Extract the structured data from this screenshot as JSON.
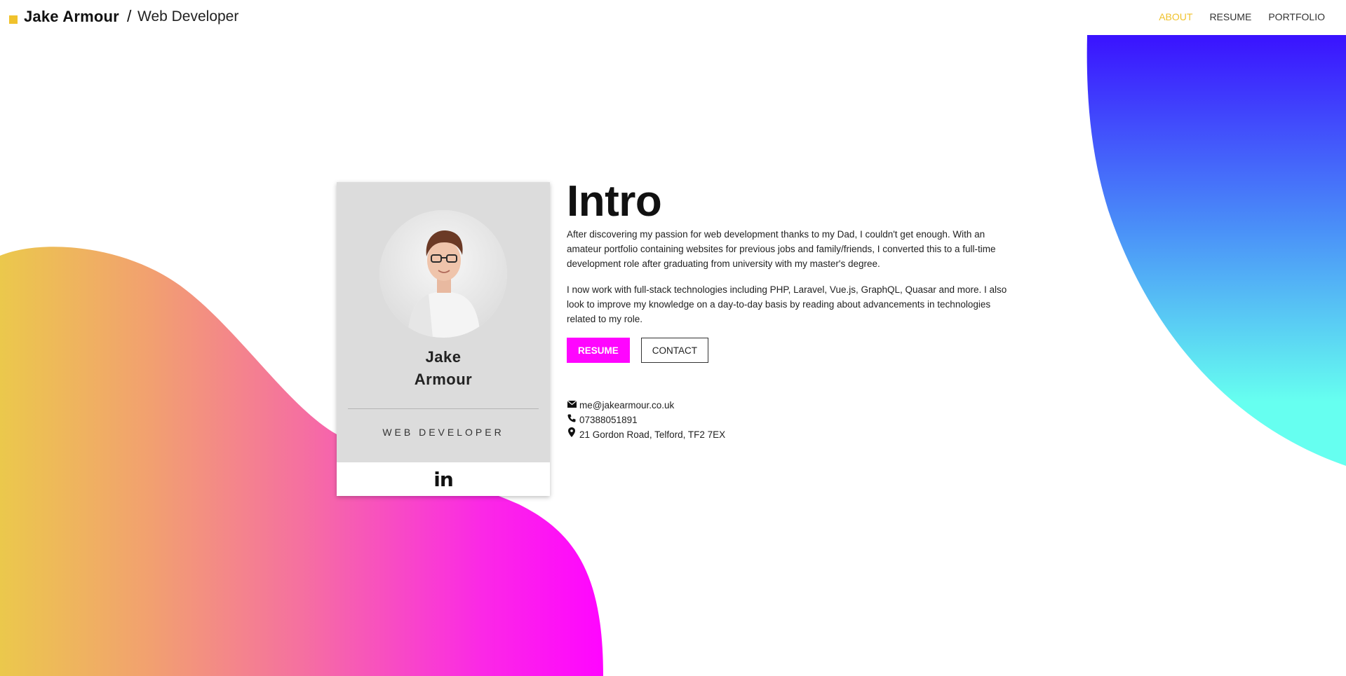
{
  "header": {
    "brand_name": "Jake Armour",
    "separator": "/",
    "brand_role": "Web Developer",
    "nav": [
      {
        "label": "ABOUT",
        "active": true
      },
      {
        "label": "RESUME",
        "active": false
      },
      {
        "label": "PORTFOLIO",
        "active": false
      }
    ]
  },
  "card": {
    "first_name": "Jake",
    "last_name": "Armour",
    "role": "WEB DEVELOPER",
    "social_icon": "linkedin-icon",
    "social_glyph": "in"
  },
  "intro": {
    "heading": "Intro",
    "paragraphs": [
      "After discovering my passion for web development thanks to my Dad, I couldn't get enough. With an amateur portfolio containing websites for previous jobs and family/friends, I converted this to a full-time development role after graduating from university with my master's degree.",
      "I now work with full-stack technologies including PHP, Laravel, Vue.js, GraphQL, Quasar and more. I also look to improve my knowledge on a day-to-day basis by reading about advancements in technologies related to my role."
    ],
    "resume_button": "RESUME",
    "contact_button": "CONTACT"
  },
  "contact": {
    "email": "me@jakearmour.co.uk",
    "phone": "07388051891",
    "address": "21 Gordon Road, Telford, TF2 7EX"
  },
  "colors": {
    "accent_yellow": "#f0c22c",
    "accent_magenta": "#ff05ff",
    "blob_right_top": "#3a12ff",
    "blob_right_bottom": "#63fff0",
    "card_bg": "#dcdcdc"
  }
}
